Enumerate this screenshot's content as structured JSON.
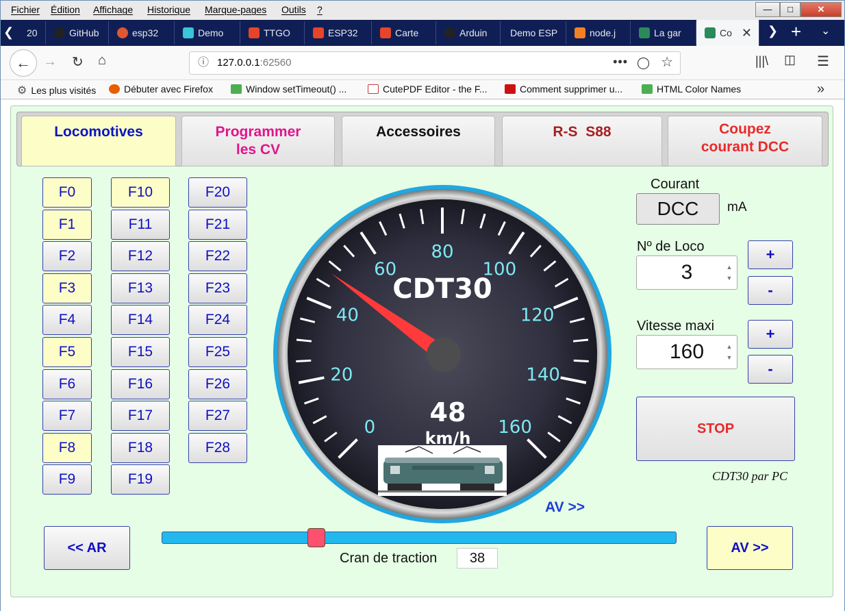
{
  "menubar": {
    "items": [
      "Fichier",
      "Édition",
      "Affichage",
      "Historique",
      "Marque-pages",
      "Outils",
      "?"
    ]
  },
  "browser_tabs": [
    {
      "label": "20",
      "icon_color": "#6a6a6a"
    },
    {
      "label": "GitHub",
      "icon_color": "#222222"
    },
    {
      "label": "esp32",
      "icon_color": "#de5833"
    },
    {
      "label": "Demo",
      "icon_color": "#38c6d9"
    },
    {
      "label": "TTGO",
      "icon_color": "#e8442a"
    },
    {
      "label": "ESP32",
      "icon_color": "#e8442a"
    },
    {
      "label": "Carte",
      "icon_color": "#e8442a"
    },
    {
      "label": "Arduin",
      "icon_color": "#222222"
    },
    {
      "label": "Demo ESP",
      "icon_color": ""
    },
    {
      "label": "node.j",
      "icon_color": "#f48024"
    },
    {
      "label": "La gar",
      "icon_color": "#2a8a5a"
    },
    {
      "label": "Co",
      "icon_color": "#2a8a5a",
      "active": true
    }
  ],
  "navbar": {
    "url_host": "127.0.0.1",
    "url_port": ":62560"
  },
  "bookmarks": [
    {
      "label": "Les plus visités",
      "icon": "gear-icon",
      "color": "#555555"
    },
    {
      "label": "Débuter avec Firefox",
      "icon": "firefox-icon",
      "color": "#e66000"
    },
    {
      "label": "Window setTimeout() ...",
      "icon": "w3-icon",
      "color": "#4caf50"
    },
    {
      "label": "CutePDF Editor - the F...",
      "icon": "pdf-icon",
      "color": "#c33c3c"
    },
    {
      "label": "Comment supprimer u...",
      "icon": "ta-icon",
      "color": "#cc1111"
    },
    {
      "label": "HTML Color Names",
      "icon": "w3-icon",
      "color": "#4caf50"
    }
  ],
  "app": {
    "tabs": [
      {
        "line1": "Locomotives",
        "line2": "",
        "color": "#0a14c0"
      },
      {
        "line1": "Programmer",
        "line2": "les CV",
        "color": "#e0158a"
      },
      {
        "line1": "Accessoires",
        "line2": "",
        "color": "#111111"
      },
      {
        "line1": "R-S  S88",
        "line2": "",
        "color": "#a82020"
      },
      {
        "line1": "Coupez",
        "line2": "courant DCC",
        "color": "#e82a2a"
      }
    ],
    "functions": {
      "col1": [
        "F0",
        "F1",
        "F2",
        "F3",
        "F4",
        "F5",
        "F6",
        "F7",
        "F8",
        "F9"
      ],
      "col2": [
        "F10",
        "F11",
        "F12",
        "F13",
        "F14",
        "F15",
        "F16",
        "F17",
        "F18",
        "F19"
      ],
      "col3": [
        "F20",
        "F21",
        "F22",
        "F23",
        "F24",
        "F25",
        "F26",
        "F27",
        "F28"
      ],
      "active": [
        "F0",
        "F1",
        "F3",
        "F5",
        "F8",
        "F10"
      ]
    },
    "gauge": {
      "name": "CDT30",
      "speed": "48",
      "unit": "km/h",
      "speed_value": 48,
      "max": 160,
      "tick_labels": [
        "0",
        "20",
        "40",
        "60",
        "80",
        "100",
        "120",
        "140",
        "160"
      ],
      "direction": "AV >>"
    },
    "courant": {
      "label": "Courant",
      "value": "DCC",
      "unit": "mA"
    },
    "loco": {
      "label": "Nº de Loco",
      "value": "3",
      "plus": "+",
      "minus": "-"
    },
    "vitesse": {
      "label": "Vitesse maxi",
      "value": "160",
      "plus": "+",
      "minus": "-"
    },
    "stop_label": "STOP",
    "credit": "CDT30 par PC",
    "ar_label": "<< AR",
    "av_label": "AV >>",
    "traction": {
      "label": "Cran de traction",
      "value": "38",
      "position": 0.3
    }
  }
}
